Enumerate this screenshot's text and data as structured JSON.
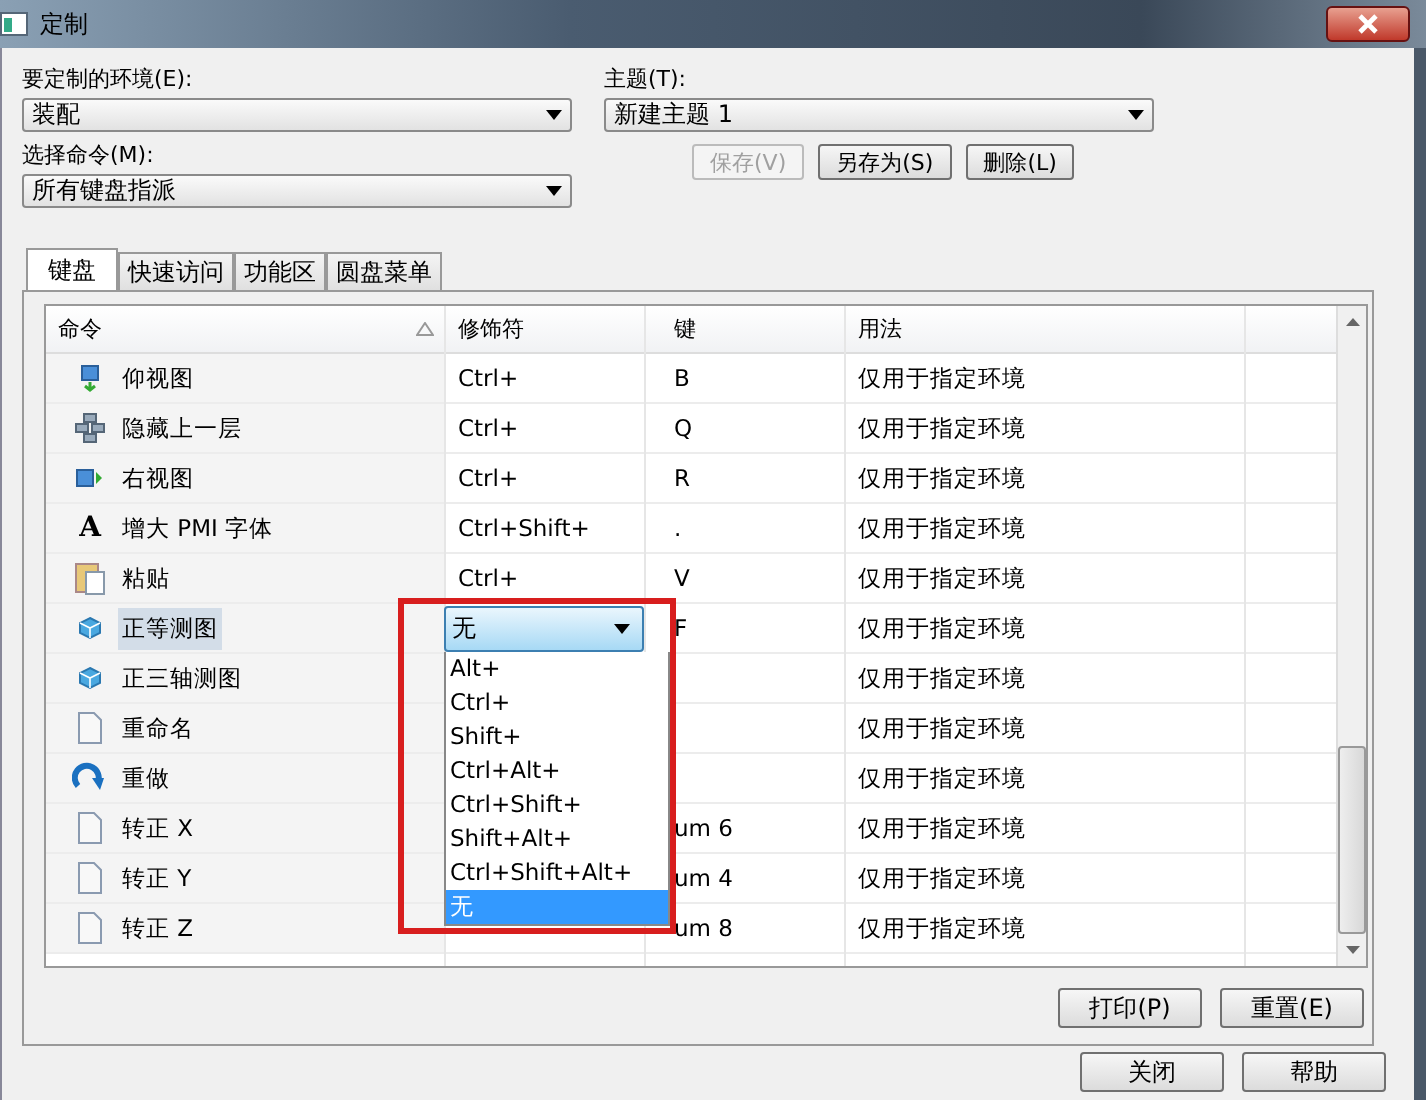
{
  "window": {
    "title": "定制"
  },
  "environment": {
    "label": "要定制的环境(E):",
    "value": "装配"
  },
  "command_set": {
    "label": "选择命令(M):",
    "value": "所有键盘指派"
  },
  "theme": {
    "label": "主题(T):",
    "value": "新建主题 1"
  },
  "theme_buttons": [
    {
      "label": "保存(V)",
      "disabled": true
    },
    {
      "label": "另存为(S)",
      "disabled": false
    },
    {
      "label": "删除(L)",
      "disabled": false
    }
  ],
  "tabs": [
    {
      "label": "键盘",
      "selected": true
    },
    {
      "label": "快速访问",
      "selected": false
    },
    {
      "label": "功能区",
      "selected": false
    },
    {
      "label": "圆盘菜单",
      "selected": false
    }
  ],
  "table": {
    "columns": [
      "命令",
      "修饰符",
      "键",
      "用法"
    ],
    "rows": [
      {
        "kind": "view-down",
        "command": "仰视图",
        "modifier": "Ctrl+",
        "key": "B",
        "usage": "仅用于指定环境",
        "selected": false
      },
      {
        "kind": "hierarchy",
        "command": "隐藏上一层",
        "modifier": "Ctrl+",
        "key": "Q",
        "usage": "仅用于指定环境",
        "selected": false
      },
      {
        "kind": "view-right",
        "command": "右视图",
        "modifier": "Ctrl+",
        "key": "R",
        "usage": "仅用于指定环境",
        "selected": false
      },
      {
        "kind": "font",
        "glyph": "A",
        "command": "增大 PMI 字体",
        "modifier": "Ctrl+Shift+",
        "key": ".",
        "usage": "仅用于指定环境",
        "selected": false
      },
      {
        "kind": "paste",
        "command": "粘贴",
        "modifier": "Ctrl+",
        "key": "V",
        "usage": "仅用于指定环境",
        "selected": false
      },
      {
        "kind": "cube",
        "command": "正等测图",
        "key": "F",
        "usage": "仅用于指定环境",
        "selected": true
      },
      {
        "kind": "cube",
        "command": "正三轴测图",
        "usage": "仅用于指定环境",
        "selected": false
      },
      {
        "kind": "doc",
        "command": "重命名",
        "usage": "仅用于指定环境",
        "selected": false
      },
      {
        "kind": "redo",
        "command": "重做",
        "usage": "仅用于指定环境",
        "selected": false
      },
      {
        "kind": "doc",
        "command": "转正 X",
        "key": "um 6",
        "usage": "仅用于指定环境",
        "selected": false
      },
      {
        "kind": "doc",
        "command": "转正 Y",
        "key": "um 4",
        "usage": "仅用于指定环境",
        "selected": false
      },
      {
        "kind": "doc",
        "command": "转正 Z",
        "key": "um 8",
        "usage": "仅用于指定环境",
        "selected": false
      }
    ]
  },
  "modifier_dropdown": {
    "value": "无",
    "highlighted": true,
    "options": [
      {
        "label": "Alt+",
        "selected": false
      },
      {
        "label": "Ctrl+",
        "selected": false
      },
      {
        "label": "Shift+",
        "selected": false
      },
      {
        "label": "Ctrl+Alt+",
        "selected": false
      },
      {
        "label": "Ctrl+Shift+",
        "selected": false
      },
      {
        "label": "Shift+Alt+",
        "selected": false
      },
      {
        "label": "Ctrl+Shift+Alt+",
        "selected": false
      },
      {
        "label": "无",
        "selected": true
      }
    ]
  },
  "panel_buttons": [
    "打印(P)",
    "重置(E)"
  ],
  "dialog_buttons": [
    "关闭",
    "帮助"
  ]
}
